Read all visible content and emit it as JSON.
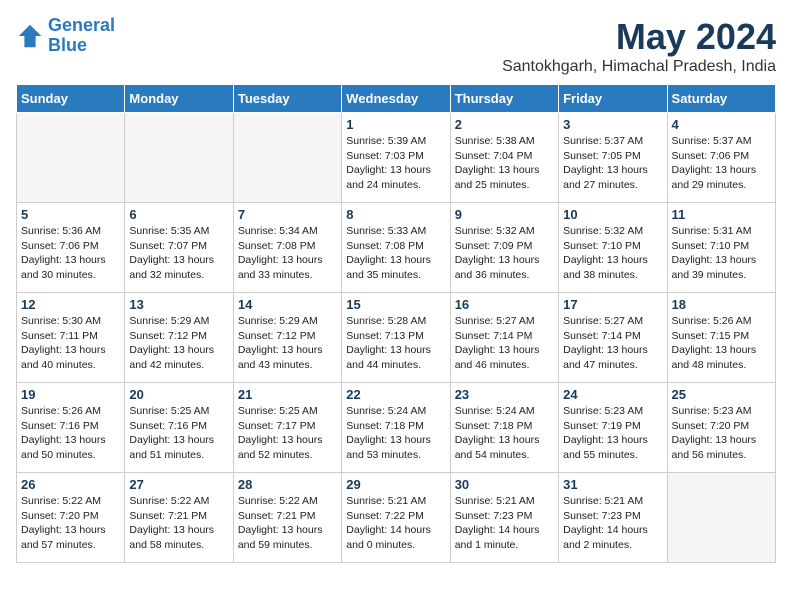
{
  "logo": {
    "line1": "General",
    "line2": "Blue"
  },
  "title": "May 2024",
  "location": "Santokhgarh, Himachal Pradesh, India",
  "days_of_week": [
    "Sunday",
    "Monday",
    "Tuesday",
    "Wednesday",
    "Thursday",
    "Friday",
    "Saturday"
  ],
  "weeks": [
    [
      {
        "day": "",
        "info": ""
      },
      {
        "day": "",
        "info": ""
      },
      {
        "day": "",
        "info": ""
      },
      {
        "day": "1",
        "sunrise": "Sunrise: 5:39 AM",
        "sunset": "Sunset: 7:03 PM",
        "daylight": "Daylight: 13 hours and 24 minutes."
      },
      {
        "day": "2",
        "sunrise": "Sunrise: 5:38 AM",
        "sunset": "Sunset: 7:04 PM",
        "daylight": "Daylight: 13 hours and 25 minutes."
      },
      {
        "day": "3",
        "sunrise": "Sunrise: 5:37 AM",
        "sunset": "Sunset: 7:05 PM",
        "daylight": "Daylight: 13 hours and 27 minutes."
      },
      {
        "day": "4",
        "sunrise": "Sunrise: 5:37 AM",
        "sunset": "Sunset: 7:06 PM",
        "daylight": "Daylight: 13 hours and 29 minutes."
      }
    ],
    [
      {
        "day": "5",
        "sunrise": "Sunrise: 5:36 AM",
        "sunset": "Sunset: 7:06 PM",
        "daylight": "Daylight: 13 hours and 30 minutes."
      },
      {
        "day": "6",
        "sunrise": "Sunrise: 5:35 AM",
        "sunset": "Sunset: 7:07 PM",
        "daylight": "Daylight: 13 hours and 32 minutes."
      },
      {
        "day": "7",
        "sunrise": "Sunrise: 5:34 AM",
        "sunset": "Sunset: 7:08 PM",
        "daylight": "Daylight: 13 hours and 33 minutes."
      },
      {
        "day": "8",
        "sunrise": "Sunrise: 5:33 AM",
        "sunset": "Sunset: 7:08 PM",
        "daylight": "Daylight: 13 hours and 35 minutes."
      },
      {
        "day": "9",
        "sunrise": "Sunrise: 5:32 AM",
        "sunset": "Sunset: 7:09 PM",
        "daylight": "Daylight: 13 hours and 36 minutes."
      },
      {
        "day": "10",
        "sunrise": "Sunrise: 5:32 AM",
        "sunset": "Sunset: 7:10 PM",
        "daylight": "Daylight: 13 hours and 38 minutes."
      },
      {
        "day": "11",
        "sunrise": "Sunrise: 5:31 AM",
        "sunset": "Sunset: 7:10 PM",
        "daylight": "Daylight: 13 hours and 39 minutes."
      }
    ],
    [
      {
        "day": "12",
        "sunrise": "Sunrise: 5:30 AM",
        "sunset": "Sunset: 7:11 PM",
        "daylight": "Daylight: 13 hours and 40 minutes."
      },
      {
        "day": "13",
        "sunrise": "Sunrise: 5:29 AM",
        "sunset": "Sunset: 7:12 PM",
        "daylight": "Daylight: 13 hours and 42 minutes."
      },
      {
        "day": "14",
        "sunrise": "Sunrise: 5:29 AM",
        "sunset": "Sunset: 7:12 PM",
        "daylight": "Daylight: 13 hours and 43 minutes."
      },
      {
        "day": "15",
        "sunrise": "Sunrise: 5:28 AM",
        "sunset": "Sunset: 7:13 PM",
        "daylight": "Daylight: 13 hours and 44 minutes."
      },
      {
        "day": "16",
        "sunrise": "Sunrise: 5:27 AM",
        "sunset": "Sunset: 7:14 PM",
        "daylight": "Daylight: 13 hours and 46 minutes."
      },
      {
        "day": "17",
        "sunrise": "Sunrise: 5:27 AM",
        "sunset": "Sunset: 7:14 PM",
        "daylight": "Daylight: 13 hours and 47 minutes."
      },
      {
        "day": "18",
        "sunrise": "Sunrise: 5:26 AM",
        "sunset": "Sunset: 7:15 PM",
        "daylight": "Daylight: 13 hours and 48 minutes."
      }
    ],
    [
      {
        "day": "19",
        "sunrise": "Sunrise: 5:26 AM",
        "sunset": "Sunset: 7:16 PM",
        "daylight": "Daylight: 13 hours and 50 minutes."
      },
      {
        "day": "20",
        "sunrise": "Sunrise: 5:25 AM",
        "sunset": "Sunset: 7:16 PM",
        "daylight": "Daylight: 13 hours and 51 minutes."
      },
      {
        "day": "21",
        "sunrise": "Sunrise: 5:25 AM",
        "sunset": "Sunset: 7:17 PM",
        "daylight": "Daylight: 13 hours and 52 minutes."
      },
      {
        "day": "22",
        "sunrise": "Sunrise: 5:24 AM",
        "sunset": "Sunset: 7:18 PM",
        "daylight": "Daylight: 13 hours and 53 minutes."
      },
      {
        "day": "23",
        "sunrise": "Sunrise: 5:24 AM",
        "sunset": "Sunset: 7:18 PM",
        "daylight": "Daylight: 13 hours and 54 minutes."
      },
      {
        "day": "24",
        "sunrise": "Sunrise: 5:23 AM",
        "sunset": "Sunset: 7:19 PM",
        "daylight": "Daylight: 13 hours and 55 minutes."
      },
      {
        "day": "25",
        "sunrise": "Sunrise: 5:23 AM",
        "sunset": "Sunset: 7:20 PM",
        "daylight": "Daylight: 13 hours and 56 minutes."
      }
    ],
    [
      {
        "day": "26",
        "sunrise": "Sunrise: 5:22 AM",
        "sunset": "Sunset: 7:20 PM",
        "daylight": "Daylight: 13 hours and 57 minutes."
      },
      {
        "day": "27",
        "sunrise": "Sunrise: 5:22 AM",
        "sunset": "Sunset: 7:21 PM",
        "daylight": "Daylight: 13 hours and 58 minutes."
      },
      {
        "day": "28",
        "sunrise": "Sunrise: 5:22 AM",
        "sunset": "Sunset: 7:21 PM",
        "daylight": "Daylight: 13 hours and 59 minutes."
      },
      {
        "day": "29",
        "sunrise": "Sunrise: 5:21 AM",
        "sunset": "Sunset: 7:22 PM",
        "daylight": "Daylight: 14 hours and 0 minutes."
      },
      {
        "day": "30",
        "sunrise": "Sunrise: 5:21 AM",
        "sunset": "Sunset: 7:23 PM",
        "daylight": "Daylight: 14 hours and 1 minute."
      },
      {
        "day": "31",
        "sunrise": "Sunrise: 5:21 AM",
        "sunset": "Sunset: 7:23 PM",
        "daylight": "Daylight: 14 hours and 2 minutes."
      },
      {
        "day": "",
        "info": ""
      }
    ]
  ]
}
